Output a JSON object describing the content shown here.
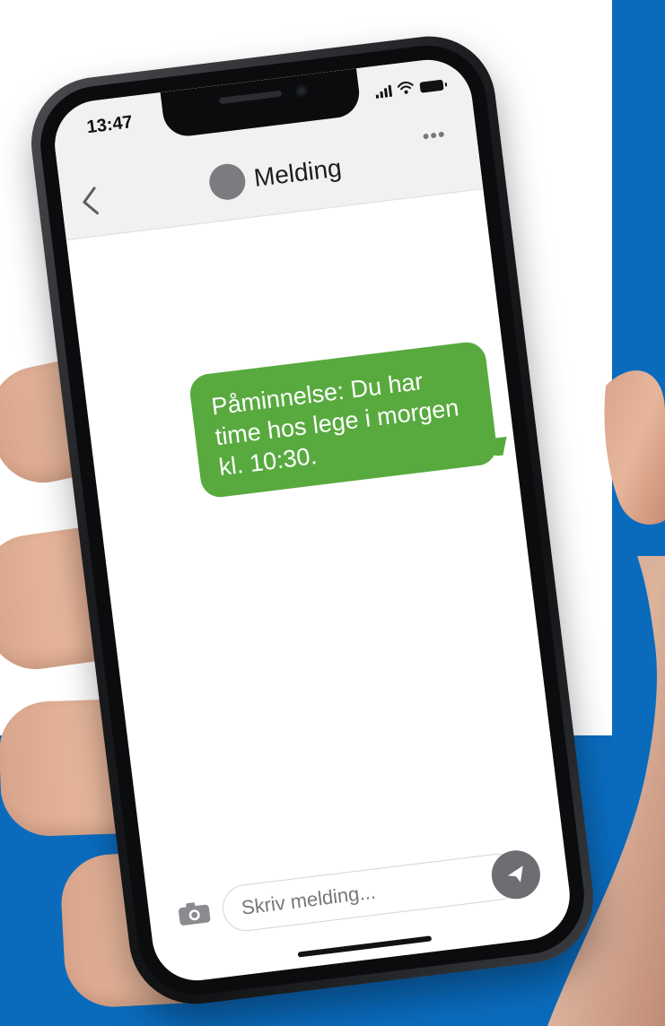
{
  "app": {
    "status_time": "13:47",
    "contact_name": "Melding",
    "menu_label": "•••",
    "message_text": "Påminnelse: Du har time hos lege i morgen kl. 10:30.",
    "input_placeholder": "Skriv melding...",
    "icons": {
      "back": "back-icon",
      "avatar": "avatar",
      "menu": "more-icon",
      "camera": "camera-icon",
      "send": "send-icon",
      "signal": "signal-icon",
      "wifi": "wifi-icon",
      "battery": "battery-icon"
    },
    "colors": {
      "accent_blue": "#0a6bbd",
      "message_green": "#58aa3f",
      "header_gray": "#f1f1f1",
      "avatar_gray": "#7b7c80",
      "send_gray": "#6d6e72"
    }
  }
}
